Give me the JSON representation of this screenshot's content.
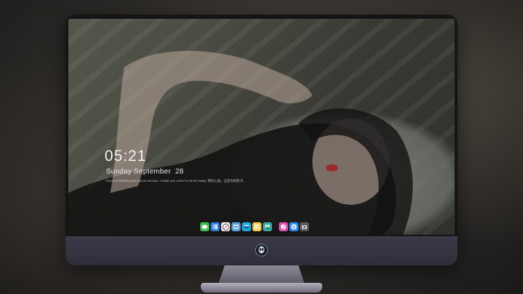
{
  "lockscreen": {
    "time": "05:21",
    "date": "Sunday September  28",
    "quote": "Forward thinking was just an excuse, I made you come to me so easily. 我的心里，全是你的影子。"
  },
  "dock": {
    "items": [
      {
        "icon": "messages-icon",
        "color": "#3fbf4a"
      },
      {
        "icon": "finder-icon",
        "color": "#2f7de1"
      },
      {
        "icon": "safari-icon",
        "color": "#e8e8e8"
      },
      {
        "icon": "preview-icon",
        "color": "#5aa0d8"
      },
      {
        "icon": "video-icon",
        "color": "#1ea7e1"
      },
      {
        "icon": "notes-icon",
        "color": "#f5c842"
      },
      {
        "icon": "photos-icon",
        "color": "#3aa6a0"
      },
      {
        "icon": "itunes-icon",
        "color": "#e04fb0"
      },
      {
        "icon": "appstore-icon",
        "color": "#2a8ef0"
      },
      {
        "icon": "camera-icon",
        "color": "#5b5b5b"
      }
    ]
  },
  "monitor": {
    "logo": "alien-logo"
  }
}
